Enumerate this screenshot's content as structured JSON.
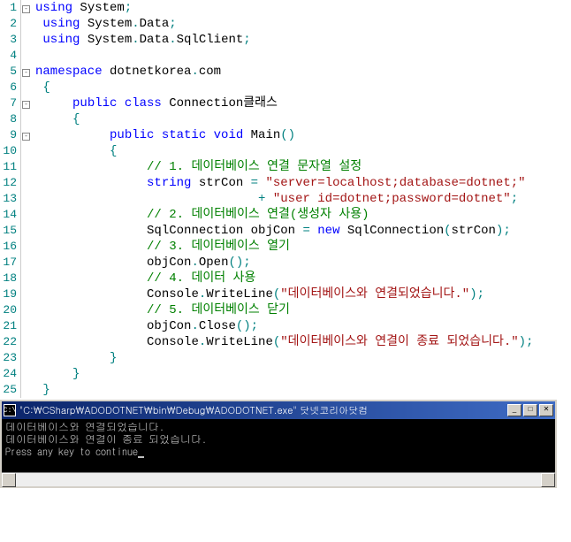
{
  "lines": [
    {
      "num": "1",
      "fold": "-",
      "indent": "",
      "tokens": [
        {
          "c": "kw",
          "t": "using"
        },
        {
          "c": "plain",
          "t": " System"
        },
        {
          "c": "brace",
          "t": ";"
        }
      ]
    },
    {
      "num": "2",
      "fold": "",
      "indent": " ",
      "tokens": [
        {
          "c": "kw",
          "t": "using"
        },
        {
          "c": "plain",
          "t": " System"
        },
        {
          "c": "brace",
          "t": "."
        },
        {
          "c": "plain",
          "t": "Data"
        },
        {
          "c": "brace",
          "t": ";"
        }
      ]
    },
    {
      "num": "3",
      "fold": "",
      "indent": " ",
      "tokens": [
        {
          "c": "kw",
          "t": "using"
        },
        {
          "c": "plain",
          "t": " System"
        },
        {
          "c": "brace",
          "t": "."
        },
        {
          "c": "plain",
          "t": "Data"
        },
        {
          "c": "brace",
          "t": "."
        },
        {
          "c": "plain",
          "t": "SqlClient"
        },
        {
          "c": "brace",
          "t": ";"
        }
      ]
    },
    {
      "num": "4",
      "fold": "",
      "indent": "",
      "tokens": []
    },
    {
      "num": "5",
      "fold": "-",
      "indent": "",
      "tokens": [
        {
          "c": "kw",
          "t": "namespace"
        },
        {
          "c": "plain",
          "t": " dotnetkorea"
        },
        {
          "c": "brace",
          "t": "."
        },
        {
          "c": "plain",
          "t": "com"
        }
      ]
    },
    {
      "num": "6",
      "fold": "",
      "indent": " ",
      "tokens": [
        {
          "c": "brace",
          "t": "{"
        }
      ]
    },
    {
      "num": "7",
      "fold": "-",
      "indent": "     ",
      "tokens": [
        {
          "c": "kw",
          "t": "public class"
        },
        {
          "c": "plain",
          "t": " Connection클래스"
        }
      ]
    },
    {
      "num": "8",
      "fold": "",
      "indent": "     ",
      "tokens": [
        {
          "c": "brace",
          "t": "{"
        }
      ]
    },
    {
      "num": "9",
      "fold": "-",
      "indent": "          ",
      "tokens": [
        {
          "c": "kw",
          "t": "public static void"
        },
        {
          "c": "plain",
          "t": " Main"
        },
        {
          "c": "brace",
          "t": "()"
        }
      ]
    },
    {
      "num": "10",
      "fold": "",
      "indent": "          ",
      "tokens": [
        {
          "c": "brace",
          "t": "{"
        }
      ]
    },
    {
      "num": "11",
      "fold": "",
      "indent": "               ",
      "tokens": [
        {
          "c": "com",
          "t": "// 1. 데이터베이스 연결 문자열 설정"
        }
      ]
    },
    {
      "num": "12",
      "fold": "",
      "indent": "               ",
      "tokens": [
        {
          "c": "kw",
          "t": "string"
        },
        {
          "c": "plain",
          "t": " strCon "
        },
        {
          "c": "brace",
          "t": "="
        },
        {
          "c": "plain",
          "t": " "
        },
        {
          "c": "str",
          "t": "\"server=localhost;database=dotnet;\""
        }
      ]
    },
    {
      "num": "13",
      "fold": "",
      "indent": "                              ",
      "tokens": [
        {
          "c": "brace",
          "t": "+"
        },
        {
          "c": "plain",
          "t": " "
        },
        {
          "c": "str",
          "t": "\"user id=dotnet;password=dotnet\""
        },
        {
          "c": "brace",
          "t": ";"
        }
      ]
    },
    {
      "num": "14",
      "fold": "",
      "indent": "               ",
      "tokens": [
        {
          "c": "com",
          "t": "// 2. 데이터베이스 연결(생성자 사용)"
        }
      ]
    },
    {
      "num": "15",
      "fold": "",
      "indent": "               ",
      "tokens": [
        {
          "c": "plain",
          "t": "SqlConnection objCon "
        },
        {
          "c": "brace",
          "t": "="
        },
        {
          "c": "plain",
          "t": " "
        },
        {
          "c": "kw",
          "t": "new"
        },
        {
          "c": "plain",
          "t": " SqlConnection"
        },
        {
          "c": "brace",
          "t": "("
        },
        {
          "c": "plain",
          "t": "strCon"
        },
        {
          "c": "brace",
          "t": ");"
        }
      ]
    },
    {
      "num": "16",
      "fold": "",
      "indent": "               ",
      "tokens": [
        {
          "c": "com",
          "t": "// 3. 데이터베이스 열기"
        }
      ]
    },
    {
      "num": "17",
      "fold": "",
      "indent": "               ",
      "tokens": [
        {
          "c": "plain",
          "t": "objCon"
        },
        {
          "c": "brace",
          "t": "."
        },
        {
          "c": "plain",
          "t": "Open"
        },
        {
          "c": "brace",
          "t": "();"
        }
      ]
    },
    {
      "num": "18",
      "fold": "",
      "indent": "               ",
      "tokens": [
        {
          "c": "com",
          "t": "// 4. 데이터 사용"
        }
      ]
    },
    {
      "num": "19",
      "fold": "",
      "indent": "               ",
      "tokens": [
        {
          "c": "plain",
          "t": "Console"
        },
        {
          "c": "brace",
          "t": "."
        },
        {
          "c": "plain",
          "t": "WriteLine"
        },
        {
          "c": "brace",
          "t": "("
        },
        {
          "c": "str",
          "t": "\"데이터베이스와 연결되었습니다.\""
        },
        {
          "c": "brace",
          "t": ");"
        }
      ]
    },
    {
      "num": "20",
      "fold": "",
      "indent": "               ",
      "tokens": [
        {
          "c": "com",
          "t": "// 5. 데이터베이스 닫기"
        }
      ]
    },
    {
      "num": "21",
      "fold": "",
      "indent": "               ",
      "tokens": [
        {
          "c": "plain",
          "t": "objCon"
        },
        {
          "c": "brace",
          "t": "."
        },
        {
          "c": "plain",
          "t": "Close"
        },
        {
          "c": "brace",
          "t": "();"
        }
      ]
    },
    {
      "num": "22",
      "fold": "",
      "indent": "               ",
      "tokens": [
        {
          "c": "plain",
          "t": "Console"
        },
        {
          "c": "brace",
          "t": "."
        },
        {
          "c": "plain",
          "t": "WriteLine"
        },
        {
          "c": "brace",
          "t": "("
        },
        {
          "c": "str",
          "t": "\"데이터베이스와 연결이 종료 되었습니다.\""
        },
        {
          "c": "brace",
          "t": ");"
        }
      ]
    },
    {
      "num": "23",
      "fold": "",
      "indent": "          ",
      "tokens": [
        {
          "c": "brace",
          "t": "}"
        }
      ]
    },
    {
      "num": "24",
      "fold": "",
      "indent": "     ",
      "tokens": [
        {
          "c": "brace",
          "t": "}"
        }
      ]
    },
    {
      "num": "25",
      "fold": "",
      "indent": " ",
      "tokens": [
        {
          "c": "brace",
          "t": "}"
        }
      ]
    }
  ],
  "console": {
    "title": "\"C:\\CSharp\\ADODOTNET\\bin\\Debug\\ADODOTNET.exe\" 닷넷코리아닷컴",
    "icon": "C:\\",
    "output": [
      "데이터베이스와 연결되었습니다.",
      "데이터베이스와 연결이 종료 되었습니다.",
      "Press any key to continue"
    ]
  }
}
